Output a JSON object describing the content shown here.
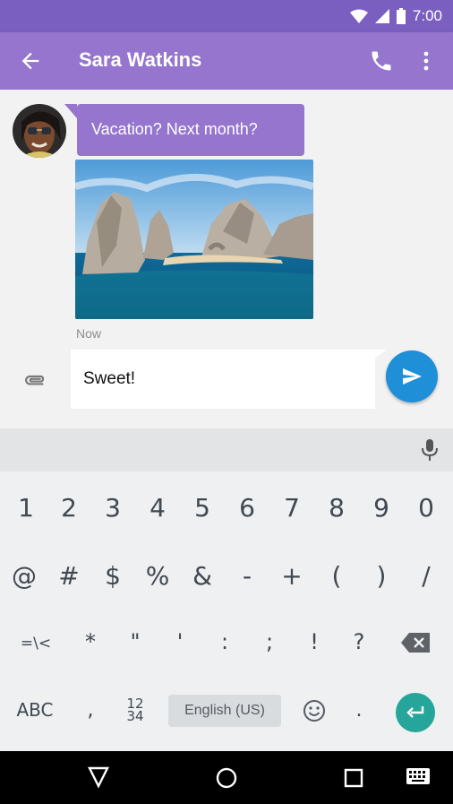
{
  "status_bar": {
    "time": "7:00"
  },
  "app_bar": {
    "title": "Sara Watkins"
  },
  "chat": {
    "message_text": "Vacation? Next month?",
    "timestamp": "Now"
  },
  "composer": {
    "input_value": "Sweet!"
  },
  "keyboard": {
    "row1": [
      "1",
      "2",
      "3",
      "4",
      "5",
      "6",
      "7",
      "8",
      "9",
      "0"
    ],
    "row2": [
      "@",
      "#",
      "$",
      "%",
      "&",
      "-",
      "+",
      "(",
      ")",
      "/"
    ],
    "row3": [
      "=\\<",
      "*",
      "\"",
      "'",
      ":",
      ";",
      "!",
      "?"
    ],
    "row4": {
      "abc": "ABC",
      "comma": ",",
      "num_top": "12",
      "num_bottom": "34",
      "language": "English (US)",
      "period": "."
    }
  },
  "colors": {
    "status_bar": "#7b5fc0",
    "app_bar": "#9575cd",
    "bubble": "#9575cd",
    "send_button": "#1f8fd8",
    "enter_key": "#26a69a"
  },
  "icons": [
    "back-arrow-icon",
    "phone-icon",
    "more-vert-icon",
    "paperclip-icon",
    "send-icon",
    "mic-icon",
    "backspace-icon",
    "emoji-icon",
    "enter-icon",
    "wifi-icon",
    "signal-icon",
    "battery-icon",
    "nav-back-icon",
    "nav-home-icon",
    "nav-recents-icon",
    "keyboard-icon"
  ]
}
